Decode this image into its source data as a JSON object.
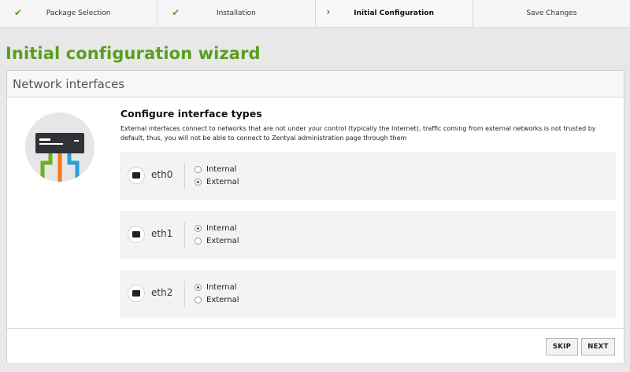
{
  "steps": [
    {
      "label": "Package Selection",
      "state": "done"
    },
    {
      "label": "Installation",
      "state": "done"
    },
    {
      "label": "Initial Configuration",
      "state": "current"
    },
    {
      "label": "Save Changes",
      "state": "pending"
    }
  ],
  "marks": {
    "done": "✔",
    "current": "›"
  },
  "wizard_title": "Initial configuration wizard",
  "panel_title": "Network interfaces",
  "section_title": "Configure interface types",
  "description": "External interfaces connect to networks that are not under your control (typically the Internet), traffic coming from external networks is not trusted by default, thus, you will not be able to connect to Zentyal administration page through them",
  "options": {
    "internal": "Internal",
    "external": "External"
  },
  "interfaces": [
    {
      "name": "eth0",
      "selected": "external"
    },
    {
      "name": "eth1",
      "selected": "internal"
    },
    {
      "name": "eth2",
      "selected": "internal"
    }
  ],
  "buttons": {
    "skip": "SKIP",
    "next": "NEXT"
  },
  "colors": {
    "accent_green": "#5a9e1f",
    "cable_green": "#6dae22",
    "cable_orange": "#f07a1a",
    "cable_blue": "#2b9fd8",
    "device_dark": "#2f3338"
  }
}
